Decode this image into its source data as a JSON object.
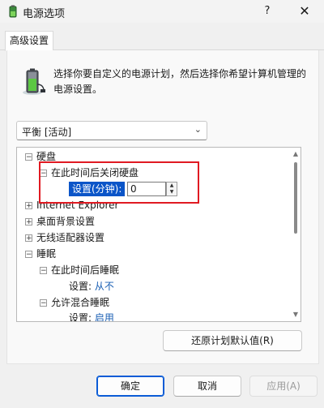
{
  "window": {
    "title": "电源选项",
    "help": "?",
    "close": "✕"
  },
  "tabs": [
    {
      "label": "高级设置"
    }
  ],
  "description": "选择你要自定义的电源计划，然后选择你希望计算机管理的电源设置。",
  "plan_select": {
    "value": "平衡 [活动]"
  },
  "tree": {
    "hard_disk": "硬盘",
    "turn_off_disk_after": "在此时间后关闭硬盘",
    "setting_minutes_label": "设置(分钟):",
    "setting_minutes_value": "0",
    "internet_explorer": "Internet Explorer",
    "desktop_background": "桌面背景设置",
    "wireless_adapter": "无线适配器设置",
    "sleep": "睡眠",
    "sleep_after": "在此时间后睡眠",
    "sleep_after_setting_label": "设置:",
    "sleep_after_setting_value": "从不",
    "allow_hybrid_sleep": "允许混合睡眠",
    "hybrid_setting_label": "设置:",
    "hybrid_setting_value": "启用"
  },
  "buttons": {
    "restore_defaults": "还原计划默认值(R)",
    "ok": "确定",
    "cancel": "取消",
    "apply": "应用(A)"
  },
  "colors": {
    "accent": "#0b55c8",
    "link": "#1a5fb4",
    "highlight": "#e01a22"
  }
}
